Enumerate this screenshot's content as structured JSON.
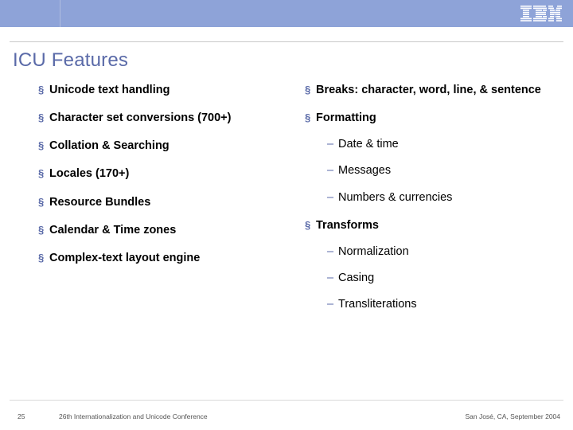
{
  "title": "ICU Features",
  "left_items": [
    {
      "label": "Unicode text handling"
    },
    {
      "label": "Character set conversions (700+)"
    },
    {
      "label": "Collation & Searching"
    },
    {
      "label": "Locales (170+)"
    },
    {
      "label": "Resource Bundles"
    },
    {
      "label": "Calendar & Time zones"
    },
    {
      "label": "Complex-text layout engine"
    }
  ],
  "right_items": [
    {
      "label": "Breaks: character, word, line, & sentence"
    },
    {
      "label": "Formatting",
      "subs": [
        "Date & time",
        "Messages",
        "Numbers & currencies"
      ]
    },
    {
      "label": "Transforms",
      "subs": [
        "Normalization",
        "Casing",
        "Transliterations"
      ]
    }
  ],
  "footer": {
    "page": "25",
    "conference": "26th Internationalization and Unicode Conference",
    "location": "San José, CA, September 2004"
  }
}
